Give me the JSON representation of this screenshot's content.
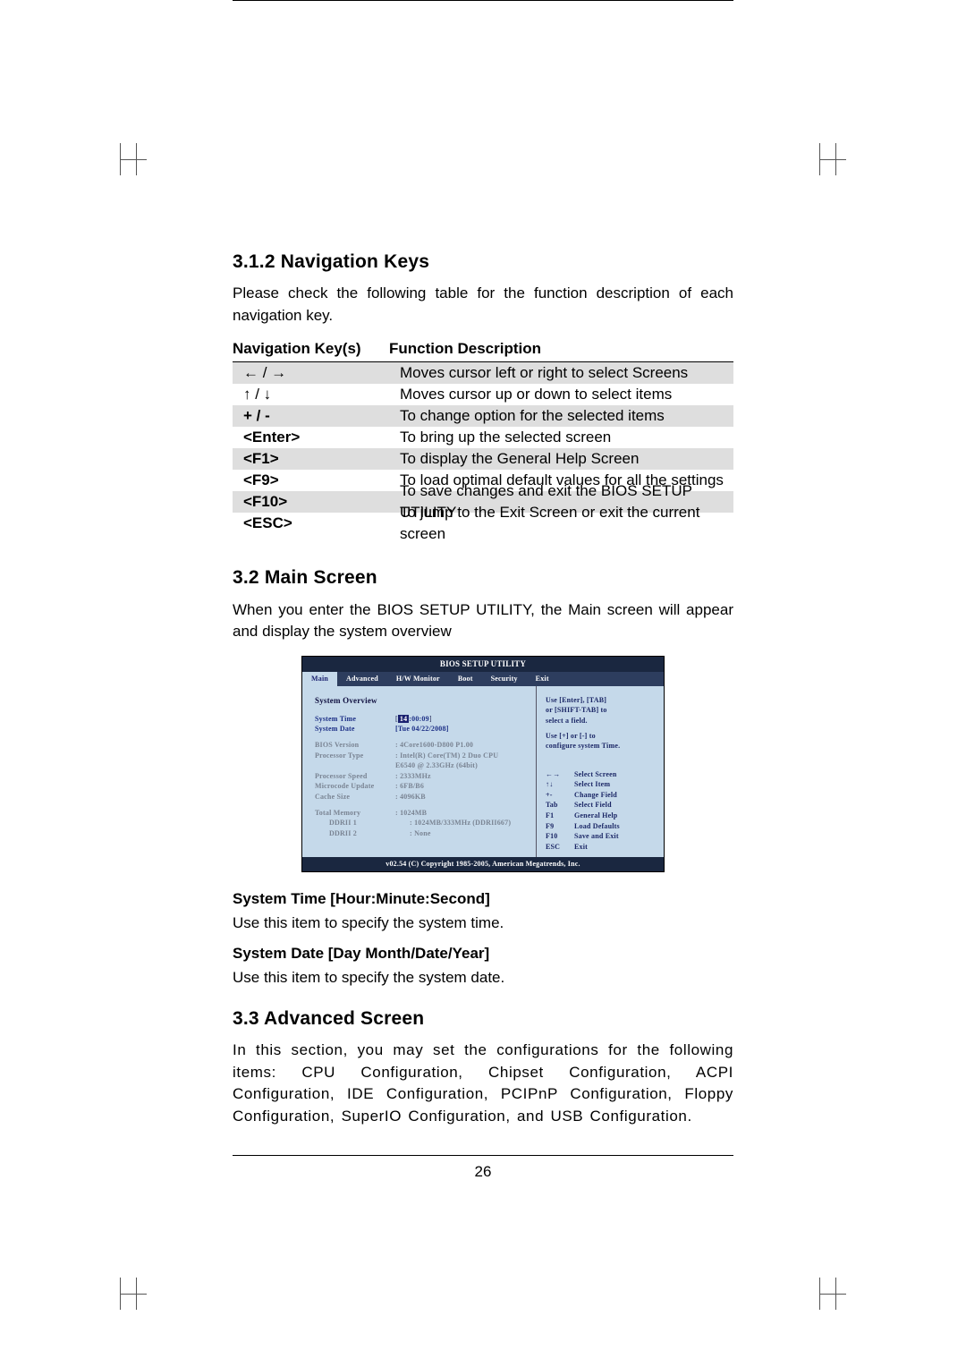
{
  "section312": {
    "title": "3.1.2 Navigation Keys",
    "intro": "Please check the following table for the function description of each navigation key.",
    "table": {
      "header_keys": "Navigation Key(s)",
      "header_desc": "Function Description",
      "rows": [
        {
          "key": "← / →",
          "desc": "Moves cursor left or right to select Screens"
        },
        {
          "key": "↑ / ↓",
          "desc": "Moves cursor up or down to select items"
        },
        {
          "key": "+  /  -",
          "desc": "To change option for the selected items"
        },
        {
          "key": "<Enter>",
          "desc": "To bring up the selected screen"
        },
        {
          "key": "<F1>",
          "desc": "To display the General Help Screen"
        },
        {
          "key": "<F9>",
          "desc": "To load optimal default values for all the settings"
        },
        {
          "key": "<F10>",
          "desc": "To save changes and exit the BIOS SETUP UTILITY"
        },
        {
          "key": "<ESC>",
          "desc": "To jump to the Exit Screen or exit the current screen"
        }
      ]
    }
  },
  "section32": {
    "title": "3.2  Main Screen",
    "intro": "When you enter the BIOS SETUP UTILITY, the Main screen will appear and display the system overview",
    "system_time": {
      "label": "System Time [Hour:Minute:Second]",
      "text": "Use this item to specify the system time."
    },
    "system_date": {
      "label": "System Date [Day Month/Date/Year]",
      "text": "Use this item to specify the system date."
    }
  },
  "section33": {
    "title": "3.3  Advanced Screen",
    "intro": "In this section, you may set the configurations for the following items: CPU Configuration, Chipset Configuration, ACPI Configuration, IDE Configuration, PCIPnP Configuration, Floppy Configuration, SuperIO Configuration, and USB Configuration."
  },
  "pagenum": "26",
  "bios": {
    "title": "BIOS SETUP UTILITY",
    "tabs": [
      "Main",
      "Advanced",
      "H/W Monitor",
      "Boot",
      "Security",
      "Exit"
    ],
    "overview": "System Overview",
    "system_time_label": "System Time",
    "system_time_value_hr": "14",
    "system_time_value_rest": ":00:09",
    "system_date_label": "System Date",
    "system_date_value": "[Tue 04/22/2008]",
    "bios_version_label": "BIOS Version",
    "bios_version_value": ": 4Core1600-D800 P1.00",
    "proc_type_label": "Processor Type",
    "proc_type_value1": ": Intel(R) Core(TM) 2 Duo CPU",
    "proc_type_value2": "  E6540 @ 2.33GHz (64bit)",
    "proc_speed_label": "Processor Speed",
    "proc_speed_value": ": 2333MHz",
    "microcode_label": "Microcode Update",
    "microcode_value": ": 6FB/B6",
    "cache_label": "Cache Size",
    "cache_value": ": 4096KB",
    "mem_label": "Total Memory",
    "mem_value": ": 1024MB",
    "ddr1_label": "DDRII 1",
    "ddr1_value": ": 1024MB/333MHz (DDRII667)",
    "ddr2_label": "DDRII 2",
    "ddr2_value": ": None",
    "help1": "Use [Enter], [TAB]",
    "help2": "or [SHIFT-TAB] to",
    "help3": "select a field.",
    "help4": "Use [+] or [-] to",
    "help5": "configure system Time.",
    "keys": [
      {
        "k": "←→",
        "l": "Select Screen"
      },
      {
        "k": "↑↓",
        "l": "Select Item"
      },
      {
        "k": "+-",
        "l": "Change Field"
      },
      {
        "k": "Tab",
        "l": "Select Field"
      },
      {
        "k": "F1",
        "l": "General Help"
      },
      {
        "k": "F9",
        "l": "Load Defaults"
      },
      {
        "k": "F10",
        "l": "Save and Exit"
      },
      {
        "k": "ESC",
        "l": "Exit"
      }
    ],
    "footer": "v02.54 (C) Copyright 1985-2005, American Megatrends, Inc."
  }
}
